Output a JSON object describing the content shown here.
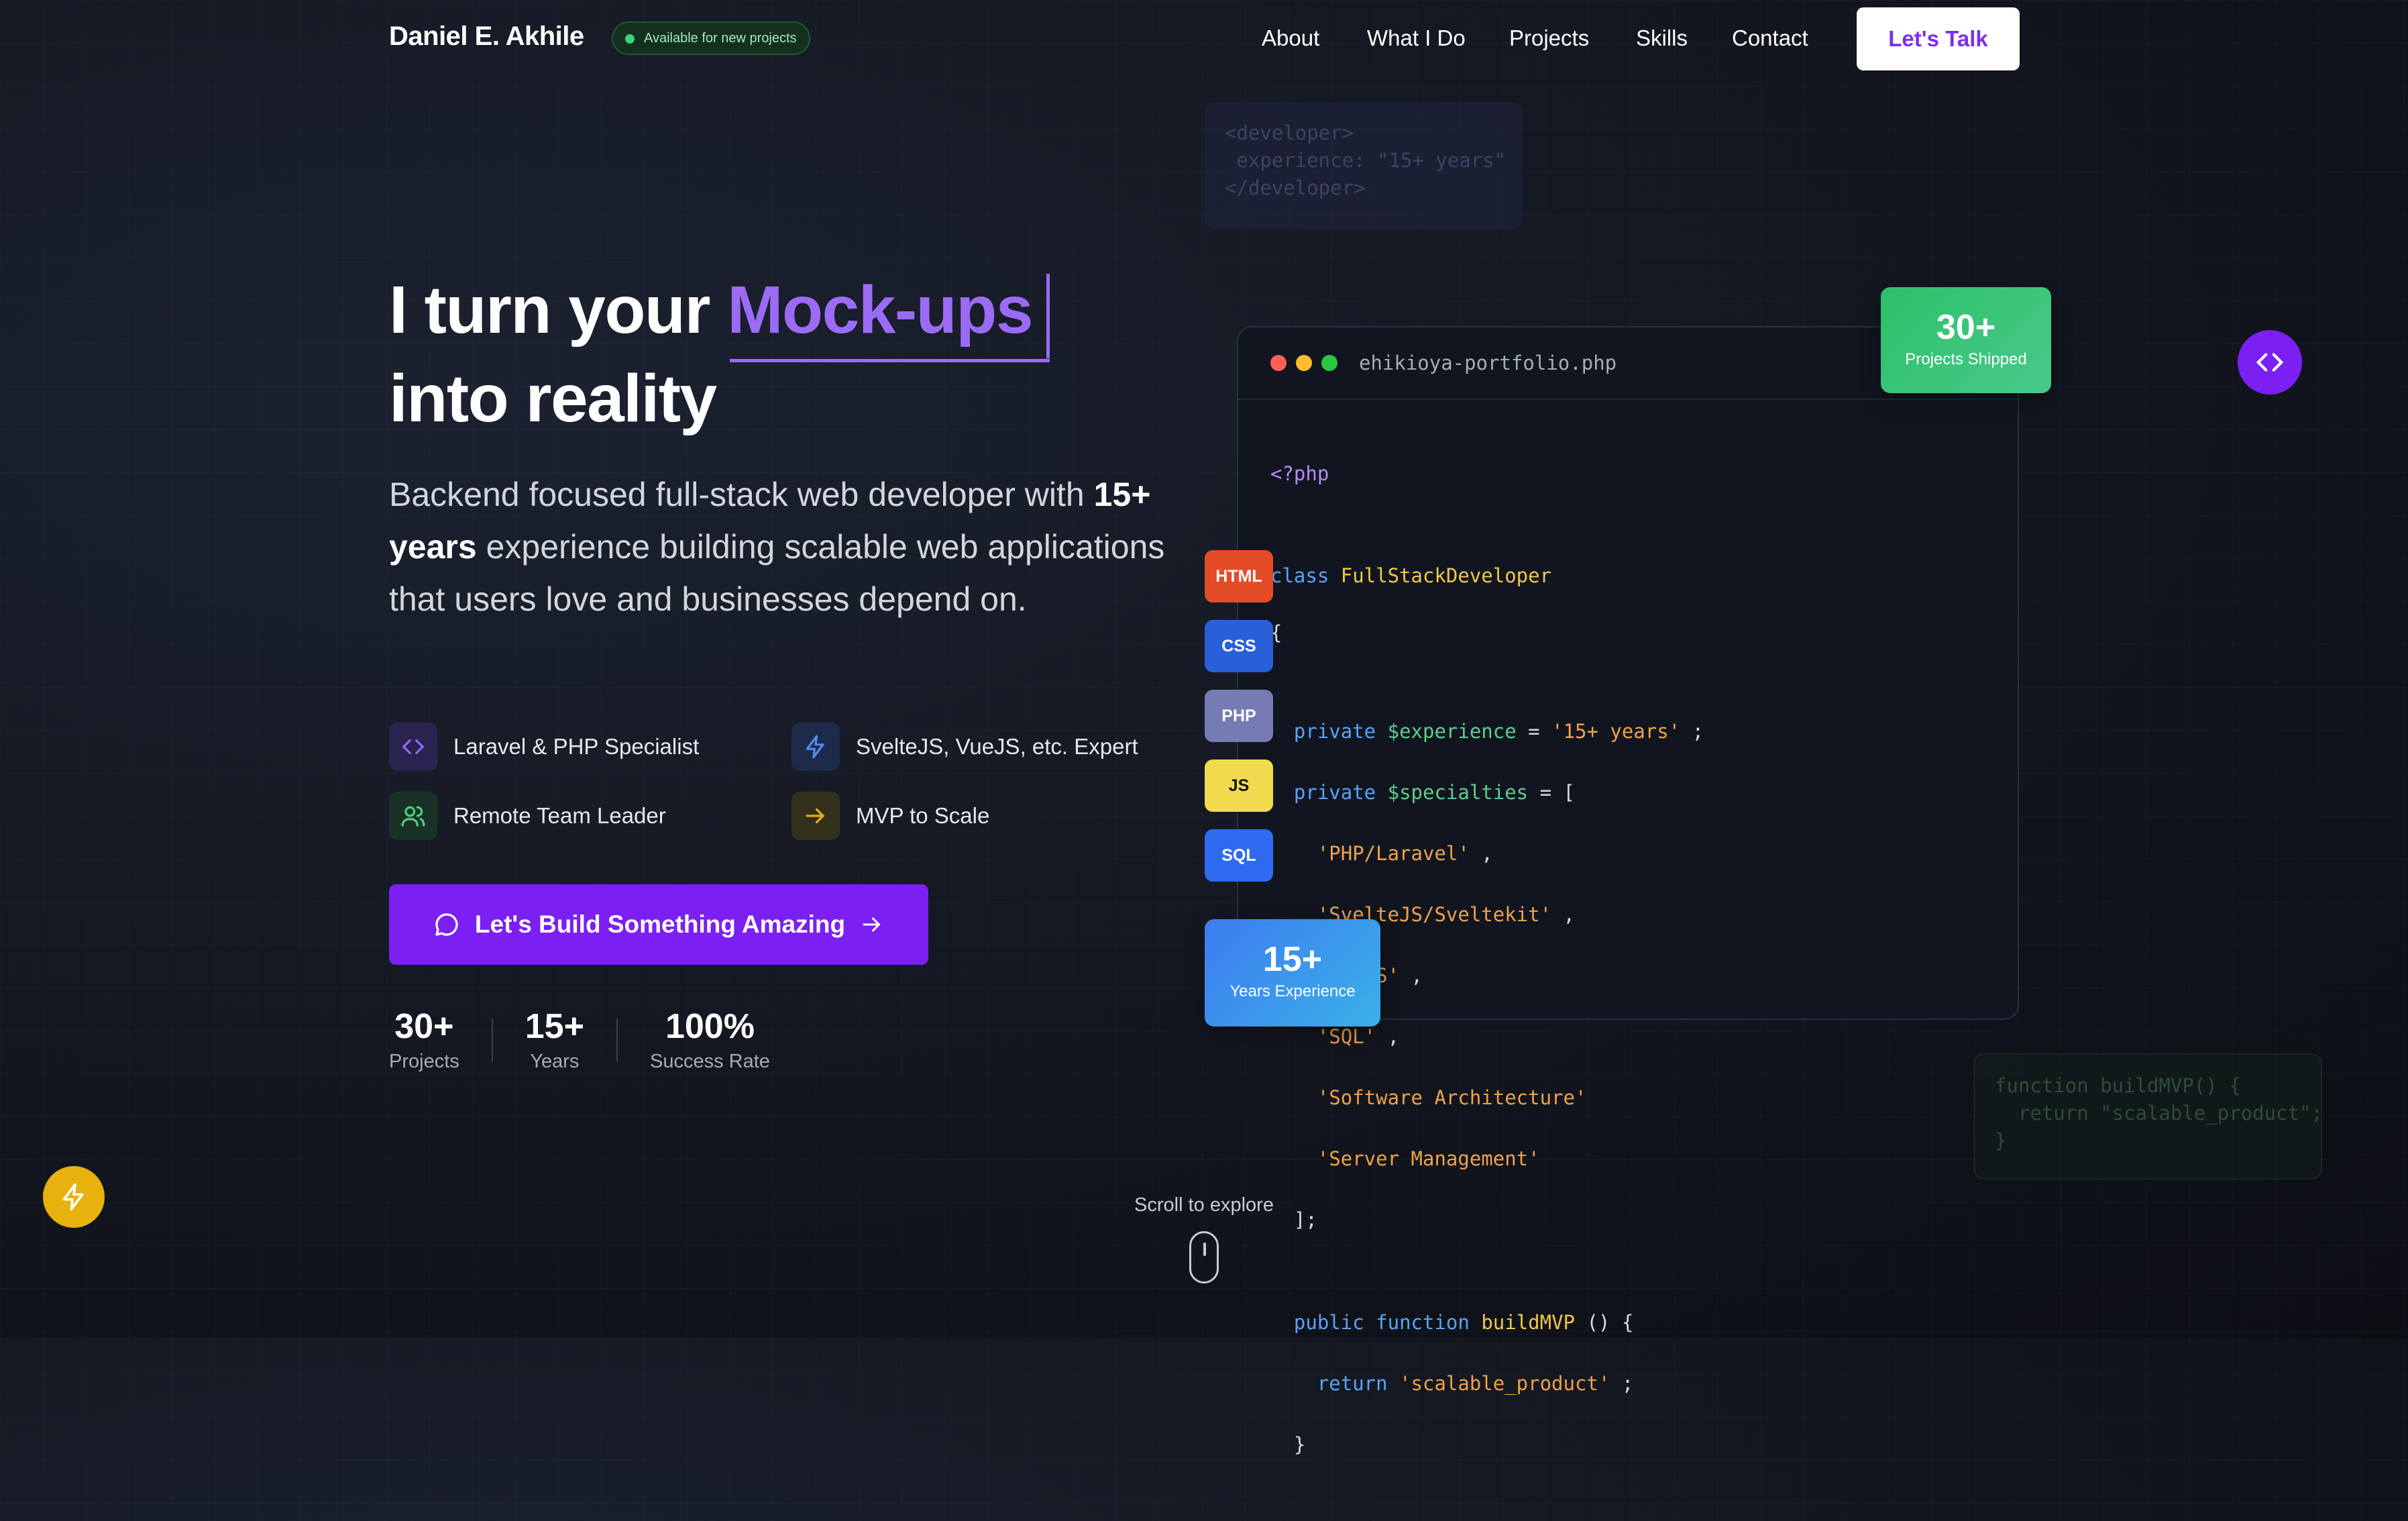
{
  "nav": {
    "brand": "Daniel E. Akhile",
    "availability": "Available for new projects",
    "links": [
      "About",
      "What I Do",
      "Projects",
      "Skills",
      "Contact"
    ],
    "cta": "Let's Talk"
  },
  "hero": {
    "title_pre": "I turn your",
    "title_highlight": "Mock-ups",
    "title_post": "into reality",
    "subtitle_pre": "Backend focused full-stack web developer with",
    "subtitle_bold": "15+ years",
    "subtitle_post": "experience building scalable web applications that users love and businesses depend on.",
    "features": [
      {
        "label": "Laravel & PHP Specialist",
        "icon": "code-icon"
      },
      {
        "label": "SvelteJS, VueJS, etc. Expert",
        "icon": "lightning-icon"
      },
      {
        "label": "Remote Team Leader",
        "icon": "users-icon"
      },
      {
        "label": "MVP to Scale",
        "icon": "arrow-right-icon"
      }
    ],
    "cta": "Let's Build Something Amazing",
    "stats": [
      {
        "value": "30+",
        "label": "Projects"
      },
      {
        "value": "15+",
        "label": "Years"
      },
      {
        "value": "100%",
        "label": "Success Rate"
      }
    ]
  },
  "code_window": {
    "filename": "ehikioya-portfolio.php",
    "lines": {
      "open": "<?php",
      "class_kw": "class",
      "class_name": "FullStackDeveloper",
      "brace_open": "{",
      "private1": "private",
      "var1": "$experience",
      "eq1": " = ",
      "val1": "'15+ years'",
      "semi1": " ;",
      "private2": "private",
      "var2": "$specialties",
      "eq2": " = [",
      "items": [
        "'PHP/Laravel'",
        "'SvelteJS/Sveltekit'",
        "'VueJS'",
        "'SQL'",
        "'Software Architecture'",
        "'Server Management'"
      ],
      "item_sep": " ,",
      "arr_close": "];",
      "public_kw": "public",
      "function_kw": "function",
      "fn_name": "buildMVP",
      "fn_sig": " () {",
      "return_kw": "return",
      "ret_val": "'scalable_product'",
      "semi2": " ;",
      "brace_close": "}"
    }
  },
  "badges": [
    "HTML",
    "CSS",
    "PHP",
    "JS",
    "SQL"
  ],
  "projects_card": {
    "value": "30+",
    "label": "Projects Shipped"
  },
  "experience_card": {
    "value": "15+",
    "label": "Years Experience"
  },
  "ghost_top": "<developer>\n experience: \"15+ years\"\n</developer>",
  "ghost_bottom": "function buildMVP() {\n  return \"scalable_product\";\n}",
  "scroll_hint": "Scroll to explore",
  "colors": {
    "accent": "#7b1ff2",
    "green": "#3fd07a",
    "yellow": "#e9b10d"
  }
}
